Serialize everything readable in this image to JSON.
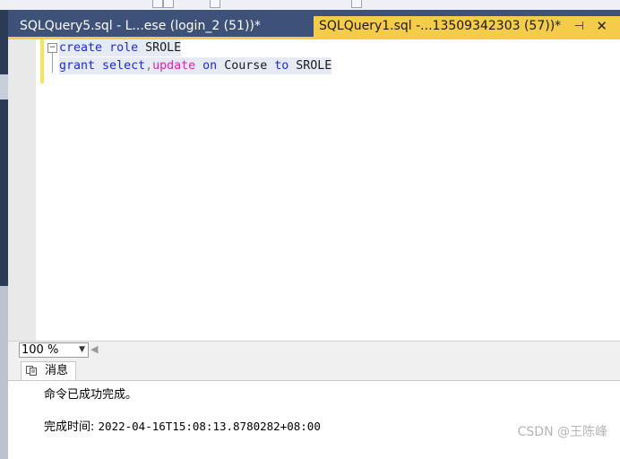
{
  "tabs": {
    "inactive_label": "SQLQuery5.sql - L...ese (login_2 (51))*",
    "active_label": "SQLQuery1.sql -...13509342303 (57))*",
    "pin_glyph": "⊣",
    "close_glyph": "✕"
  },
  "editor": {
    "fold_glyph": "−",
    "line1": {
      "t1": "create",
      "t2": " ",
      "t3": "role",
      "t4": " SROLE"
    },
    "line2": {
      "t1": "grant",
      "t2": " ",
      "t3": "select",
      "t4": ",",
      "t5": "update",
      "t6": " ",
      "t7": "on",
      "t8": " Course ",
      "t9": "to",
      "t10": " SROLE"
    }
  },
  "zoom": {
    "value": "100 %",
    "arrow": "▼",
    "scroll_arrow": "◀"
  },
  "messages": {
    "tab_label": "消息",
    "line1": "命令已成功完成。",
    "line2_label": "完成时间: ",
    "line2_value": "2022-04-16T15:08:13.8780282+08:00"
  },
  "watermark": "CSDN @王陈峰",
  "colors": {
    "tab_active": "#f5cc4a",
    "tab_bar": "#3e5178",
    "keyword": "#1a2bd8",
    "function_keyword": "#e020b6"
  }
}
